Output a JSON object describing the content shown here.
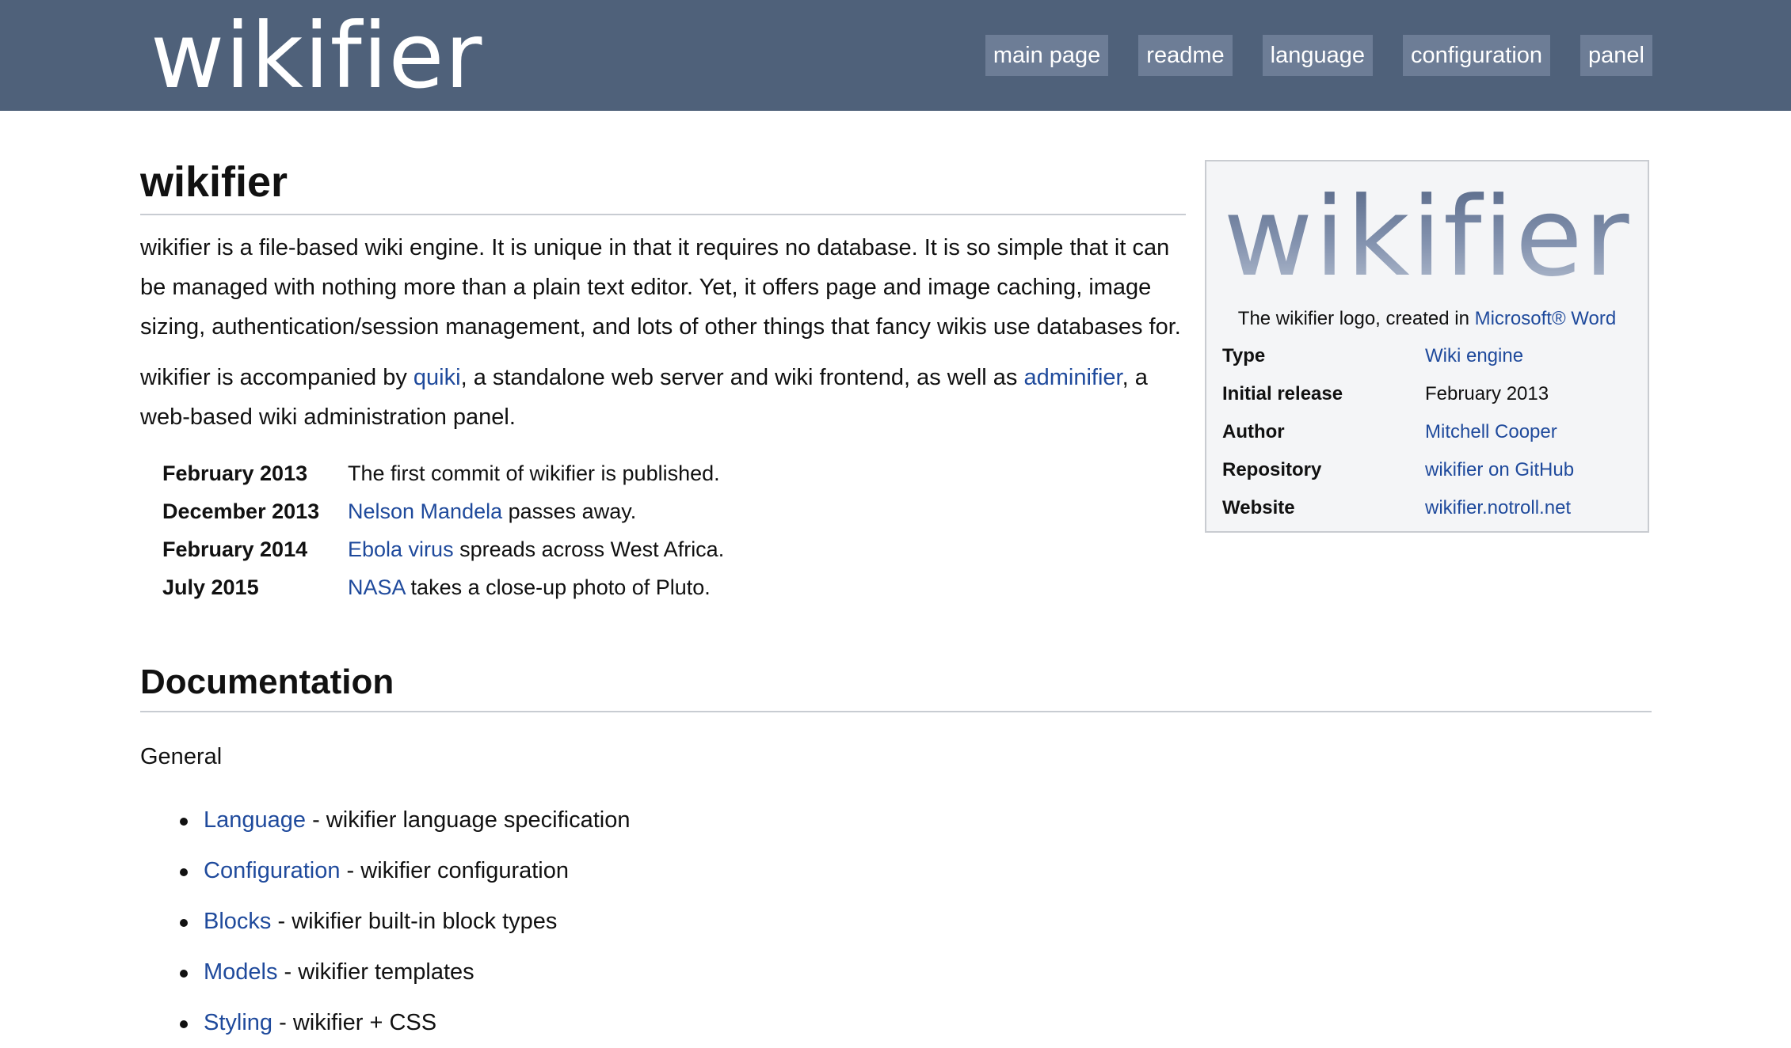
{
  "header": {
    "brand": "wikifier",
    "nav": [
      "main page",
      "readme",
      "language",
      "configuration",
      "panel"
    ]
  },
  "article": {
    "title": "wikifier",
    "intro": "wikifier is a file-based wiki engine. It is unique in that it requires no database. It is so simple that it can be managed with nothing more than a plain text editor. Yet, it offers page and image caching, image sizing, authentication/session management, and lots of other things that fancy wikis use databases for.",
    "para2": {
      "pre": "wikifier is accompanied by ",
      "link1": "quiki",
      "mid": ", a standalone web server and wiki frontend, as well as ",
      "link2": "adminifier",
      "post": ", a web-based wiki administration panel."
    },
    "timeline": [
      {
        "date": "February 2013",
        "link": "",
        "text": "The first commit of wikifier is published."
      },
      {
        "date": "December 2013",
        "link": "Nelson Mandela",
        "text": " passes away."
      },
      {
        "date": "February 2014",
        "link": "Ebola virus",
        "text": " spreads across West Africa."
      },
      {
        "date": "July 2015",
        "link": "NASA",
        "text": " takes a close-up photo of Pluto."
      }
    ]
  },
  "infobox": {
    "logo_text": "wikifier",
    "caption_pre": "The wikifier logo, created in ",
    "caption_link": "Microsoft® Word",
    "rows": [
      {
        "key": "Type",
        "value": "Wiki engine",
        "is_link": true
      },
      {
        "key": "Initial release",
        "value": "February 2013",
        "is_link": false
      },
      {
        "key": "Author",
        "value": "Mitchell Cooper",
        "is_link": true
      },
      {
        "key": "Repository",
        "value": "wikifier on GitHub",
        "is_link": true
      },
      {
        "key": "Website",
        "value": "wikifier.notroll.net",
        "is_link": true
      }
    ]
  },
  "documentation": {
    "title": "Documentation",
    "subheading": "General",
    "items": [
      {
        "link": "Language",
        "desc": " - wikifier language specification"
      },
      {
        "link": "Configuration",
        "desc": " - wikifier configuration"
      },
      {
        "link": "Blocks",
        "desc": " - wikifier built-in block types"
      },
      {
        "link": "Models",
        "desc": " - wikifier templates"
      },
      {
        "link": "Styling",
        "desc": " - wikifier + CSS"
      }
    ]
  },
  "colors": {
    "header_bg": "#4f617a",
    "nav_button_bg": "#6d7d96",
    "link": "#1f4a9c",
    "infobox_bg": "#f4f5f7"
  }
}
